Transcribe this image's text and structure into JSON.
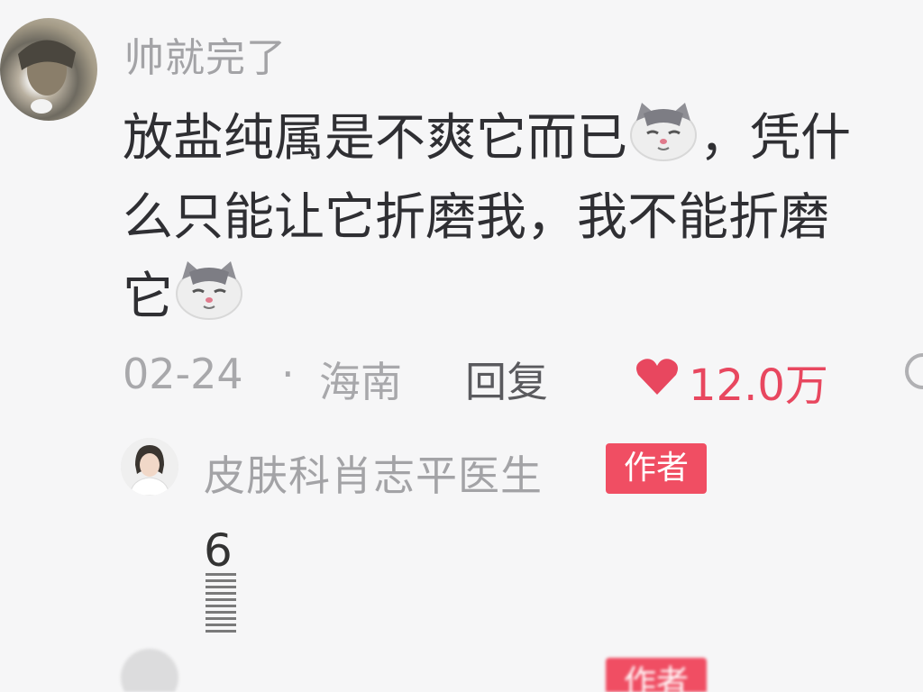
{
  "comment": {
    "username": "帅就完了",
    "lines": [
      "放盐纯属是不爽它而已",
      "，凭什",
      "么只能让它折磨我，我不能折磨",
      "它"
    ],
    "emoji_icon": "cat-face-icon",
    "date": "02-24",
    "separator": "·",
    "location": "海南",
    "reply_label": "回复",
    "like_count": "12.0万",
    "like_icon": "heart-icon"
  },
  "author_reply": {
    "name": "皮肤科肖志平医生",
    "badge": "作者",
    "glitch_char": "6"
  },
  "next_reply": {
    "badge": "作者"
  },
  "colors": {
    "background": "#f6f6f7",
    "accent": "#f04e63",
    "like": "#e8475f",
    "muted_text": "#a3a3a6"
  }
}
